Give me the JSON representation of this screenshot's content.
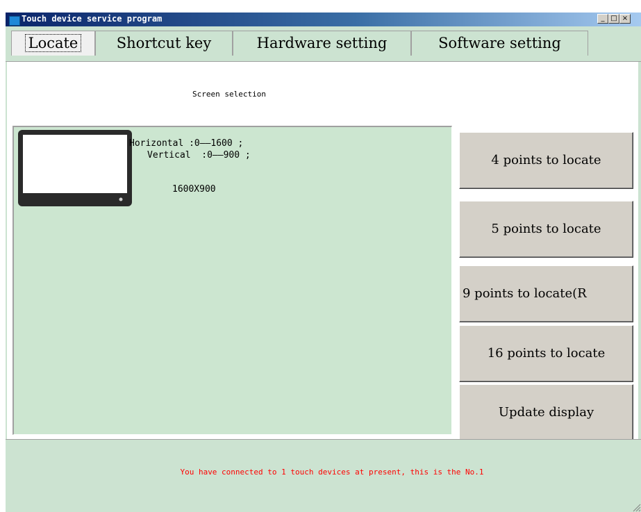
{
  "window": {
    "title": "Touch device service program",
    "controls": {
      "minimize": "_",
      "maximize": "□",
      "close": "×"
    }
  },
  "tabs": [
    {
      "label": "Locate",
      "active": true
    },
    {
      "label": "Shortcut key",
      "active": false
    },
    {
      "label": "Hardware setting",
      "active": false
    },
    {
      "label": "Software setting",
      "active": false
    }
  ],
  "locate": {
    "screen_selection_label": "Screen selection",
    "horizontal_label": "Horizontal :0——1600 ;",
    "vertical_label": "Vertical  :0——900 ;",
    "resolution": "1600X900"
  },
  "buttons": {
    "four_points": "4 points to locate",
    "five_points": "5 points to locate",
    "nine_points": "9 points to locate(R",
    "sixteen_points": "16 points to locate",
    "update_display": "Update display"
  },
  "status": {
    "message": "You have connected to 1 touch devices at present, this is the No.1"
  },
  "colors": {
    "window_bg": "#cce3d1",
    "panel_bg": "#cce6d0",
    "button_bg": "#d4d0c8",
    "status_text": "#ff0000",
    "titlebar_start": "#0a246a",
    "titlebar_end": "#a6caf0"
  },
  "icons": [
    "app-icon",
    "monitor-icon",
    "resize-grip-icon"
  ]
}
